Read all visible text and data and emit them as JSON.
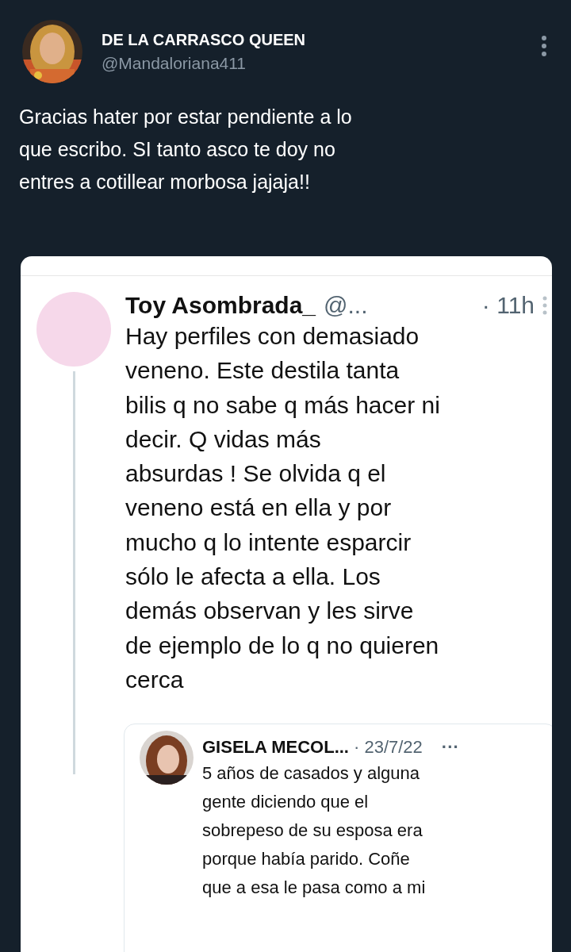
{
  "tweet": {
    "author_name": "DE LA CARRASCO QUEEN",
    "handle": "@Mandaloriana411",
    "text": "Gracias hater por estar pendiente a lo\nque escribo.  SI tanto asco te doy no\nentres a cotillear morbosa  jajaja!!"
  },
  "screenshot": {
    "reply": {
      "author_name": "Toy Asombrada_",
      "handle": "@...",
      "time": "· 11h",
      "text": "Hay perfiles con demasiado\nveneno. Este destila tanta\nbilis q no sabe q más hacer ni\ndecir.  Q vidas más\nabsurdas ! Se olvida q el\nveneno está en ella y por\nmucho q lo intente esparcir\nsólo le afecta a ella. Los\ndemás observan y les sirve\nde ejemplo de lo q no quieren\ncerca"
    },
    "quoted": {
      "author_name": "GISELA MECOL...",
      "time": "· 23/7/22",
      "more": "···",
      "text": "5 años de casados y alguna\ngente diciendo que el\nsobrepeso de su esposa era\nporque había parido. Coñe\nque a esa le pasa como a mi"
    }
  }
}
